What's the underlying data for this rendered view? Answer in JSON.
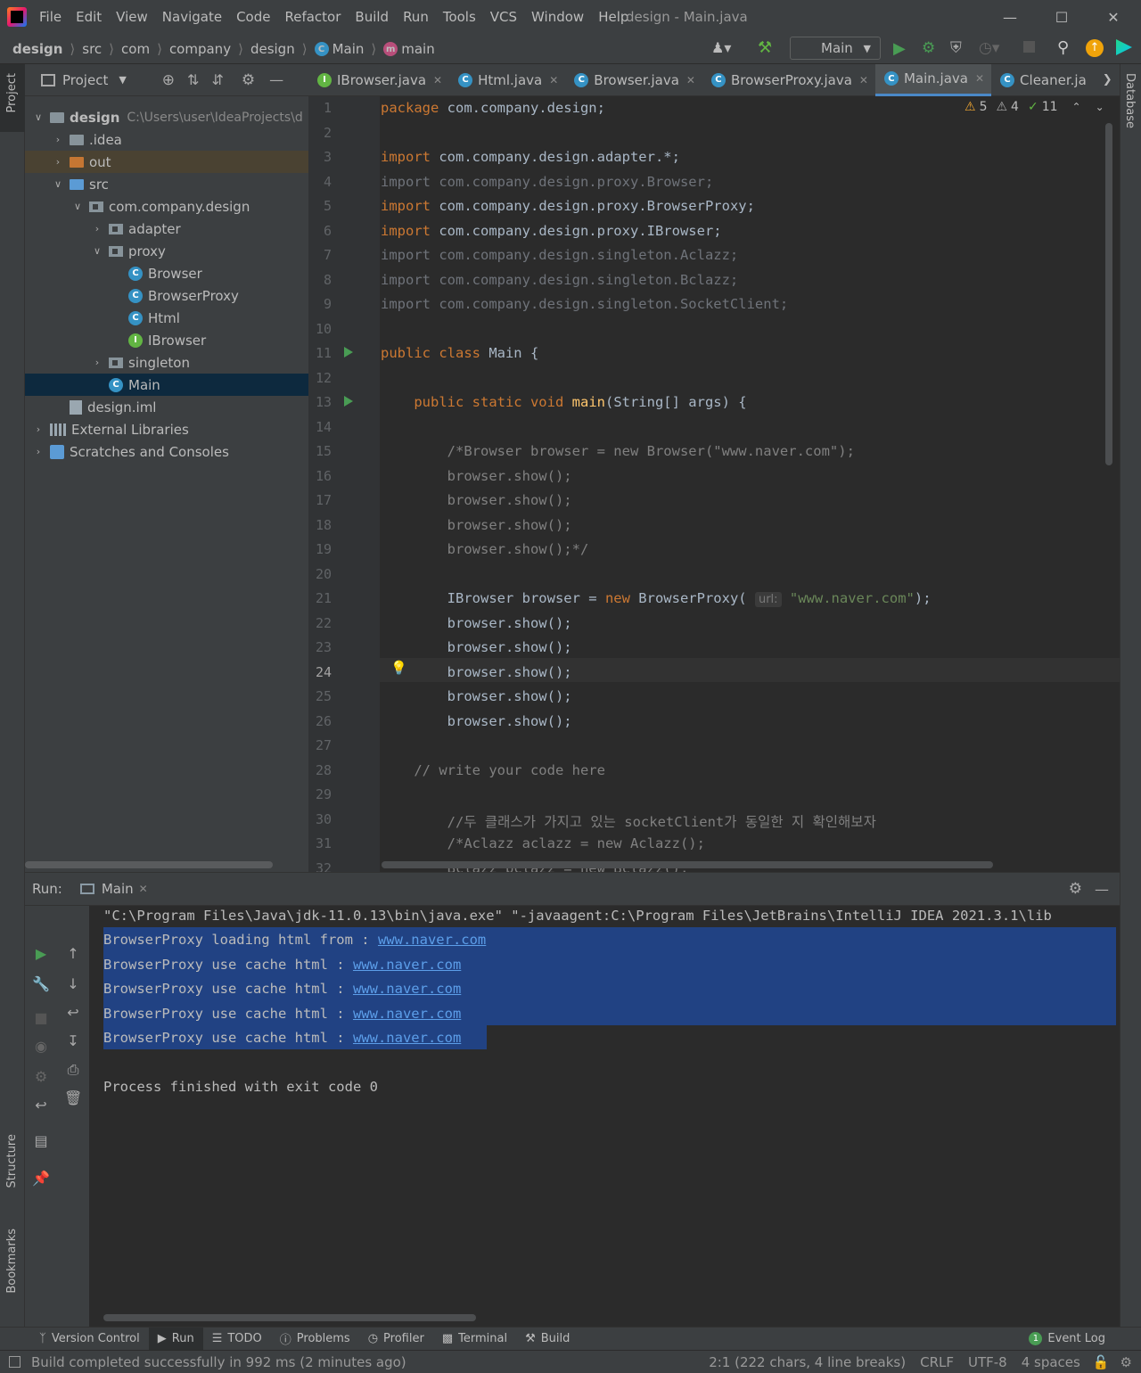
{
  "window": {
    "title": "design - Main.java",
    "menu": [
      "File",
      "Edit",
      "View",
      "Navigate",
      "Code",
      "Refactor",
      "Build",
      "Run",
      "Tools",
      "VCS",
      "Window",
      "Help"
    ]
  },
  "navbar": {
    "crumbs": [
      "design",
      "src",
      "com",
      "company",
      "design",
      "Main",
      "main"
    ],
    "run_config": "Main"
  },
  "project": {
    "header": "Project",
    "tree": [
      {
        "label": "design",
        "path": "C:\\Users\\user\\IdeaProjects\\d",
        "level": 0,
        "arrow": "v",
        "icon": "folder"
      },
      {
        "label": ".idea",
        "level": 1,
        "arrow": ">",
        "icon": "folder"
      },
      {
        "label": "out",
        "level": 1,
        "arrow": ">",
        "icon": "folder-orange"
      },
      {
        "label": "src",
        "level": 1,
        "arrow": "v",
        "icon": "folder-blue"
      },
      {
        "label": "com.company.design",
        "level": 2,
        "arrow": "v",
        "icon": "package"
      },
      {
        "label": "adapter",
        "level": 3,
        "arrow": ">",
        "icon": "package"
      },
      {
        "label": "proxy",
        "level": 3,
        "arrow": "v",
        "icon": "package"
      },
      {
        "label": "Browser",
        "level": 4,
        "arrow": "",
        "icon": "class"
      },
      {
        "label": "BrowserProxy",
        "level": 4,
        "arrow": "",
        "icon": "class"
      },
      {
        "label": "Html",
        "level": 4,
        "arrow": "",
        "icon": "class"
      },
      {
        "label": "IBrowser",
        "level": 4,
        "arrow": "",
        "icon": "interface"
      },
      {
        "label": "singleton",
        "level": 3,
        "arrow": ">",
        "icon": "package"
      },
      {
        "label": "Main",
        "level": 3,
        "arrow": "",
        "icon": "class-main"
      },
      {
        "label": "design.iml",
        "level": 1,
        "arrow": "",
        "icon": "file"
      },
      {
        "label": "External Libraries",
        "level": 0,
        "arrow": ">",
        "icon": "library"
      },
      {
        "label": "Scratches and Consoles",
        "level": 0,
        "arrow": ">",
        "icon": "scratch"
      }
    ]
  },
  "tabs": [
    {
      "label": "IBrowser.java",
      "icon": "interface"
    },
    {
      "label": "Html.java",
      "icon": "class"
    },
    {
      "label": "Browser.java",
      "icon": "class"
    },
    {
      "label": "BrowserProxy.java",
      "icon": "class"
    },
    {
      "label": "Main.java",
      "icon": "class-main",
      "active": true
    },
    {
      "label": "Cleaner.ja",
      "icon": "class"
    }
  ],
  "inspections": {
    "warnings": "5",
    "weak_warnings": "4",
    "typos": "11"
  },
  "editor": {
    "line_numbers": [
      "1",
      "2",
      "3",
      "4",
      "5",
      "6",
      "7",
      "8",
      "9",
      "10",
      "11",
      "12",
      "13",
      "14",
      "15",
      "16",
      "17",
      "18",
      "19",
      "20",
      "21",
      "22",
      "23",
      "24",
      "25",
      "26",
      "27",
      "28",
      "29",
      "30",
      "31",
      "32"
    ],
    "current_line": "24",
    "param_hint": "url:"
  },
  "run": {
    "label": "Run:",
    "tab": "Main",
    "command": "\"C:\\Program Files\\Java\\jdk-11.0.13\\bin\\java.exe\" \"-javaagent:C:\\Program Files\\JetBrains\\IntelliJ IDEA 2021.3.1\\lib",
    "output": [
      {
        "text": "BrowserProxy loading html from : ",
        "link": "www.naver.com"
      },
      {
        "text": "BrowserProxy use cache html : ",
        "link": "www.naver.com"
      },
      {
        "text": "BrowserProxy use cache html : ",
        "link": "www.naver.com"
      },
      {
        "text": "BrowserProxy use cache html : ",
        "link": "www.naver.com"
      },
      {
        "text": "BrowserProxy use cache html : ",
        "link": "www.naver.com"
      }
    ],
    "exit": "Process finished with exit code 0"
  },
  "bottom_tools": [
    "Version Control",
    "Run",
    "TODO",
    "Problems",
    "Profiler",
    "Terminal",
    "Build"
  ],
  "event_log": {
    "count": "1",
    "label": "Event Log"
  },
  "status": {
    "message": "Build completed successfully in 992 ms (2 minutes ago)",
    "position": "2:1 (222 chars, 4 line breaks)",
    "line_sep": "CRLF",
    "encoding": "UTF-8",
    "indent": "4 spaces"
  },
  "side_labels": {
    "project": "Project",
    "structure": "Structure",
    "bookmarks": "Bookmarks",
    "database": "Database"
  }
}
